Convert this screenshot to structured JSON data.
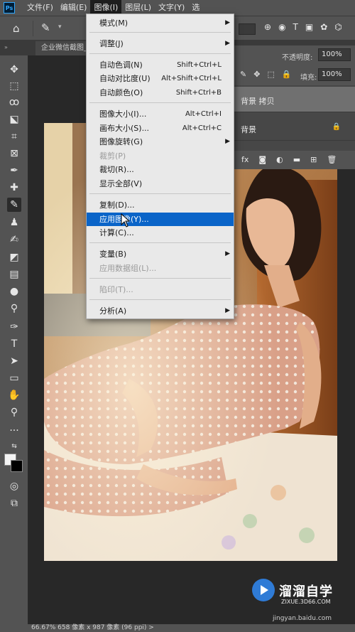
{
  "menubar": {
    "items": [
      "文件(F)",
      "编辑(E)",
      "图像(I)",
      "图层(L)",
      "文字(Y)",
      "选"
    ]
  },
  "tab": {
    "label": "企业微信截图_"
  },
  "panel": {
    "opacity_label": "不透明度:",
    "opacity_value": "100%",
    "fill_label": "填充:",
    "fill_value": "100%",
    "layers": [
      "背景 拷贝",
      "背景"
    ]
  },
  "dropdown": {
    "items": [
      {
        "label": "模式(M)",
        "shortcut": "",
        "submenu": true,
        "disabled": false
      },
      {
        "label": "调整(J)",
        "shortcut": "",
        "submenu": true,
        "disabled": false
      },
      {
        "label": "自动色调(N)",
        "shortcut": "Shift+Ctrl+L",
        "submenu": false,
        "disabled": false
      },
      {
        "label": "自动对比度(U)",
        "shortcut": "Alt+Shift+Ctrl+L",
        "submenu": false,
        "disabled": false
      },
      {
        "label": "自动颜色(O)",
        "shortcut": "Shift+Ctrl+B",
        "submenu": false,
        "disabled": false
      },
      {
        "label": "图像大小(I)...",
        "shortcut": "Alt+Ctrl+I",
        "submenu": false,
        "disabled": false
      },
      {
        "label": "画布大小(S)...",
        "shortcut": "Alt+Ctrl+C",
        "submenu": false,
        "disabled": false
      },
      {
        "label": "图像旋转(G)",
        "shortcut": "",
        "submenu": true,
        "disabled": false
      },
      {
        "label": "裁剪(P)",
        "shortcut": "",
        "submenu": false,
        "disabled": true
      },
      {
        "label": "裁切(R)...",
        "shortcut": "",
        "submenu": false,
        "disabled": false
      },
      {
        "label": "显示全部(V)",
        "shortcut": "",
        "submenu": false,
        "disabled": false
      },
      {
        "label": "复制(D)...",
        "shortcut": "",
        "submenu": false,
        "disabled": false
      },
      {
        "label": "应用图像(Y)...",
        "shortcut": "",
        "submenu": false,
        "disabled": false
      },
      {
        "label": "计算(C)...",
        "shortcut": "",
        "submenu": false,
        "disabled": false
      },
      {
        "label": "变量(B)",
        "shortcut": "",
        "submenu": true,
        "disabled": false
      },
      {
        "label": "应用数据组(L)...",
        "shortcut": "",
        "submenu": false,
        "disabled": true
      },
      {
        "label": "陷印(T)...",
        "shortcut": "",
        "submenu": false,
        "disabled": true
      },
      {
        "label": "分析(A)",
        "shortcut": "",
        "submenu": true,
        "disabled": false
      }
    ],
    "highlighted": "应用图像(Y)..."
  },
  "watermark": {
    "title": "溜溜自学",
    "sub": "ZIXUE.3D66.COM",
    "url": "jingyan.baidu.com"
  },
  "status": {
    "text": "66.67%    658 像素 x 987 像素 (96 ppi)    >"
  },
  "icons": {
    "home": "home-icon",
    "brush": "brush-icon"
  }
}
